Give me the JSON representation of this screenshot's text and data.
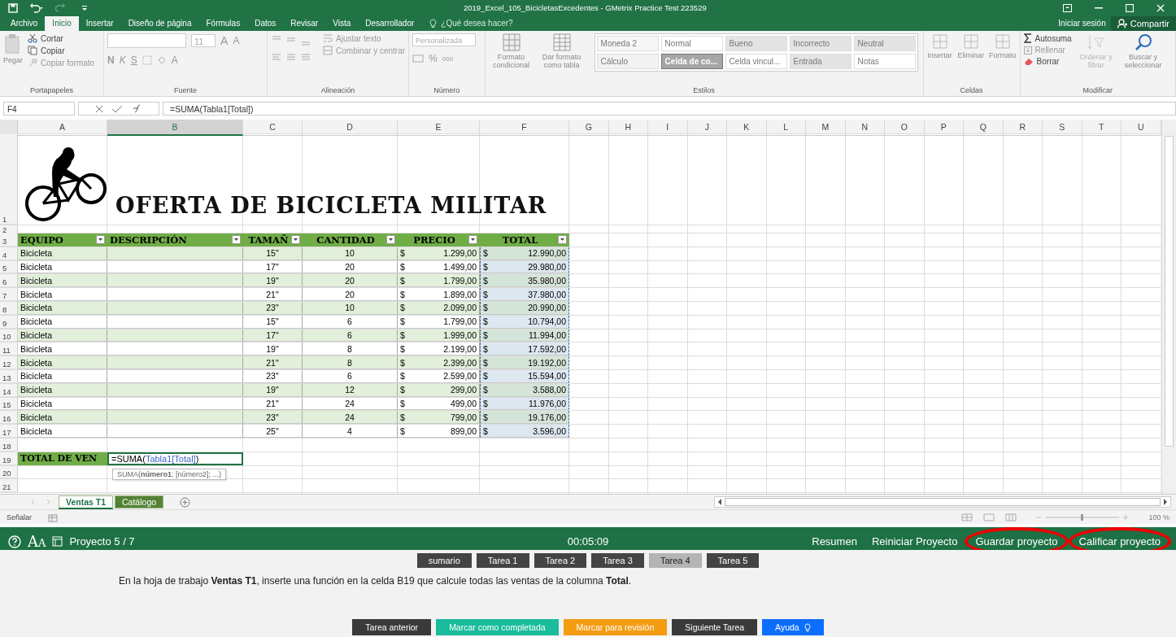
{
  "window": {
    "title": "2019_Excel_105_BicicletasExcedentes - GMetrix Practice Test 223529"
  },
  "ribbon_tabs": [
    {
      "label": "Archivo",
      "selected": false
    },
    {
      "label": "Inicio",
      "selected": true
    },
    {
      "label": "Insertar",
      "selected": false
    },
    {
      "label": "Diseño de página",
      "selected": false
    },
    {
      "label": "Fórmulas",
      "selected": false
    },
    {
      "label": "Datos",
      "selected": false
    },
    {
      "label": "Revisar",
      "selected": false
    },
    {
      "label": "Vista",
      "selected": false
    },
    {
      "label": "Desarrollador",
      "selected": false
    }
  ],
  "tell_me": {
    "placeholder": "¿Qué desea hacer?"
  },
  "account": {
    "sign_in": "Iniciar sesión",
    "share": "Compartir"
  },
  "ribbon": {
    "clipboard": {
      "label": "Portapapeles",
      "paste": "Pegar",
      "cut": "Cortar",
      "copy": "Copiar",
      "format_painter": "Copiar formato"
    },
    "font": {
      "label": "Fuente",
      "size": "11",
      "grow": "A",
      "shrink": "A",
      "bold": "N",
      "italic": "K",
      "underline": "S",
      "font_color": "A"
    },
    "alignment": {
      "label": "Alineación",
      "wrap": "Ajustar texto",
      "merge": "Combinar y centrar"
    },
    "number": {
      "label": "Número",
      "format": "Personalizada",
      "percent": "%",
      "thousands": "000"
    },
    "styles": {
      "label": "Estilos",
      "conditional": "Formato condicional",
      "as_table": "Dar formato como tabla",
      "gallery": [
        {
          "label": "Moneda 2",
          "color": "#f7f7f7",
          "selected": false
        },
        {
          "label": "Normal",
          "color": "#ffffff",
          "selected": false
        },
        {
          "label": "Bueno",
          "color": "#e4e4e4",
          "selected": false
        },
        {
          "label": "Incorrecto",
          "color": "#e4e4e4",
          "selected": false
        },
        {
          "label": "Neutral",
          "color": "#e4e4e4",
          "selected": false
        },
        {
          "label": "Cálculo",
          "color": "#f2f2f2",
          "selected": false
        },
        {
          "label": "Celda de co...",
          "color": "#a6a6a6",
          "selected": true
        },
        {
          "label": "Celda vincul...",
          "color": "#ffffff",
          "selected": false
        },
        {
          "label": "Entrada",
          "color": "#e4e4e4",
          "selected": false
        },
        {
          "label": "Notas",
          "color": "#ffffff",
          "selected": false
        }
      ]
    },
    "cells": {
      "label": "Celdas",
      "items": [
        "Insertar",
        "Eliminar",
        "Formato"
      ]
    },
    "editing": {
      "label": "Modificar",
      "autosum": "Autosuma",
      "fill": "Rellenar",
      "clear": "Borrar",
      "sort": "Ordenar y filtrar",
      "find": "Buscar y seleccionar"
    }
  },
  "formula_bar": {
    "name_box": "F4",
    "formula": "=SUMA(Tabla1[Total])"
  },
  "sheet": {
    "columns": [
      {
        "label": "A",
        "selected": false
      },
      {
        "label": "B",
        "selected": true
      },
      {
        "label": "C",
        "selected": false
      },
      {
        "label": "D",
        "selected": false
      },
      {
        "label": "E",
        "selected": false
      },
      {
        "label": "F",
        "selected": false
      },
      {
        "label": "G",
        "selected": false
      },
      {
        "label": "H",
        "selected": false
      },
      {
        "label": "I",
        "selected": false
      },
      {
        "label": "J",
        "selected": false
      },
      {
        "label": "K",
        "selected": false
      },
      {
        "label": "L",
        "selected": false
      },
      {
        "label": "M",
        "selected": false
      },
      {
        "label": "N",
        "selected": false
      },
      {
        "label": "O",
        "selected": false
      },
      {
        "label": "P",
        "selected": false
      },
      {
        "label": "Q",
        "selected": false
      },
      {
        "label": "R",
        "selected": false
      },
      {
        "label": "S",
        "selected": false
      },
      {
        "label": "T",
        "selected": false
      },
      {
        "label": "U",
        "selected": false
      }
    ],
    "marquee": true,
    "rows": [
      {
        "number": "1",
        "kind": "title",
        "title": "OFERTA DE BICICLETA MILITAR"
      },
      {
        "number": "2",
        "kind": "blank"
      },
      {
        "number": "3",
        "kind": "header",
        "cells": [
          "EQUIPO",
          "DESCRIPCIÓN",
          "TAMAÑ",
          "CANTIDAD",
          "PRECIO",
          "TOTAL"
        ]
      },
      {
        "number": "4",
        "kind": "data",
        "item": "Bicicleta",
        "size": "15\"",
        "qty": "10",
        "price_cur": "$",
        "price": "1.299,00",
        "total_cur": "$",
        "total": "12.990,00"
      },
      {
        "number": "5",
        "kind": "data",
        "item": "Bicicleta",
        "size": "17\"",
        "qty": "20",
        "price_cur": "$",
        "price": "1.499,00",
        "total_cur": "$",
        "total": "29.980,00"
      },
      {
        "number": "6",
        "kind": "data",
        "item": "Bicicleta",
        "size": "19\"",
        "qty": "20",
        "price_cur": "$",
        "price": "1.799,00",
        "total_cur": "$",
        "total": "35.980,00"
      },
      {
        "number": "7",
        "kind": "data",
        "item": "Bicicleta",
        "size": "21\"",
        "qty": "20",
        "price_cur": "$",
        "price": "1.899,00",
        "total_cur": "$",
        "total": "37.980,00"
      },
      {
        "number": "8",
        "kind": "data",
        "item": "Bicicleta",
        "size": "23\"",
        "qty": "10",
        "price_cur": "$",
        "price": "2.099,00",
        "total_cur": "$",
        "total": "20.990,00"
      },
      {
        "number": "9",
        "kind": "data",
        "item": "Bicicleta",
        "size": "15\"",
        "qty": "6",
        "price_cur": "$",
        "price": "1.799,00",
        "total_cur": "$",
        "total": "10.794,00"
      },
      {
        "number": "10",
        "kind": "data",
        "item": "Bicicleta",
        "size": "17\"",
        "qty": "6",
        "price_cur": "$",
        "price": "1.999,00",
        "total_cur": "$",
        "total": "11.994,00"
      },
      {
        "number": "11",
        "kind": "data",
        "item": "Bicicleta",
        "size": "19\"",
        "qty": "8",
        "price_cur": "$",
        "price": "2.199,00",
        "total_cur": "$",
        "total": "17.592,00"
      },
      {
        "number": "12",
        "kind": "data",
        "item": "Bicicleta",
        "size": "21\"",
        "qty": "8",
        "price_cur": "$",
        "price": "2.399,00",
        "total_cur": "$",
        "total": "19.192,00"
      },
      {
        "number": "13",
        "kind": "data",
        "item": "Bicicleta",
        "size": "23\"",
        "qty": "6",
        "price_cur": "$",
        "price": "2.599,00",
        "total_cur": "$",
        "total": "15.594,00"
      },
      {
        "number": "14",
        "kind": "data",
        "item": "Bicicleta",
        "size": "19\"",
        "qty": "12",
        "price_cur": "$",
        "price": "299,00",
        "total_cur": "$",
        "total": "3.588,00"
      },
      {
        "number": "15",
        "kind": "data",
        "item": "Bicicleta",
        "size": "21\"",
        "qty": "24",
        "price_cur": "$",
        "price": "499,00",
        "total_cur": "$",
        "total": "11.976,00"
      },
      {
        "number": "16",
        "kind": "data",
        "item": "Bicicleta",
        "size": "23\"",
        "qty": "24",
        "price_cur": "$",
        "price": "799,00",
        "total_cur": "$",
        "total": "19.176,00"
      },
      {
        "number": "17",
        "kind": "data",
        "item": "Bicicleta",
        "size": "25\"",
        "qty": "4",
        "price_cur": "$",
        "price": "899,00",
        "total_cur": "$",
        "total": "3.596,00"
      },
      {
        "number": "18",
        "kind": "blank"
      },
      {
        "number": "19",
        "kind": "total",
        "label": "TOTAL DE VEN",
        "parts": [
          {
            "text": "=SUMA(",
            "kind": "plain"
          },
          {
            "text": "Tabla1[Total]",
            "kind": "ref"
          },
          {
            "text": ")",
            "kind": "plain"
          }
        ],
        "tooltip": "SUMA(**número1**; [número2]; ...)"
      },
      {
        "number": "20",
        "kind": "blank"
      },
      {
        "number": "21",
        "kind": "blank"
      }
    ],
    "tabs": [
      {
        "label": "Ventas T1",
        "selected": true,
        "color": "#ffffff"
      },
      {
        "label": "Catálogo",
        "selected": false,
        "color": "#548235"
      }
    ]
  },
  "status_bar": {
    "mode": "Señalar",
    "zoom": "100 %"
  },
  "project_bar": {
    "font_glyph": "AA",
    "project": "Proyecto 5 / 7",
    "timer": "00:05:09",
    "links": [
      {
        "label": "Resumen",
        "annotated": false
      },
      {
        "label": "Reiniciar Proyecto",
        "annotated": false
      },
      {
        "label": "Guardar proyecto",
        "annotated": true
      },
      {
        "label": "Calificar proyecto",
        "annotated": true
      }
    ]
  },
  "task_tabs": [
    {
      "label": "sumario",
      "selected": false
    },
    {
      "label": "Tarea 1",
      "selected": false
    },
    {
      "label": "Tarea 2",
      "selected": false
    },
    {
      "label": "Tarea 3",
      "selected": false
    },
    {
      "label": "Tarea 4",
      "selected": true
    },
    {
      "label": "Tarea 5",
      "selected": false
    }
  ],
  "instruction": "En la hoja de trabajo **Ventas T1**, inserte una función en la celda B19 que calcule todas las ventas de la columna **Total**.",
  "actions": [
    {
      "label": "Tarea anterior",
      "color": "#3a3a3a",
      "kind": "plain"
    },
    {
      "label": "Marcar como completada",
      "color": "#1abc9c",
      "kind": "plain"
    },
    {
      "label": "Marcar para revisión",
      "color": "#f39c12",
      "kind": "plain"
    },
    {
      "label": "Siguiente Tarea",
      "color": "#3a3a3a",
      "kind": "plain"
    },
    {
      "label": "Ayuda",
      "color": "#0d6efd",
      "kind": "help"
    }
  ]
}
